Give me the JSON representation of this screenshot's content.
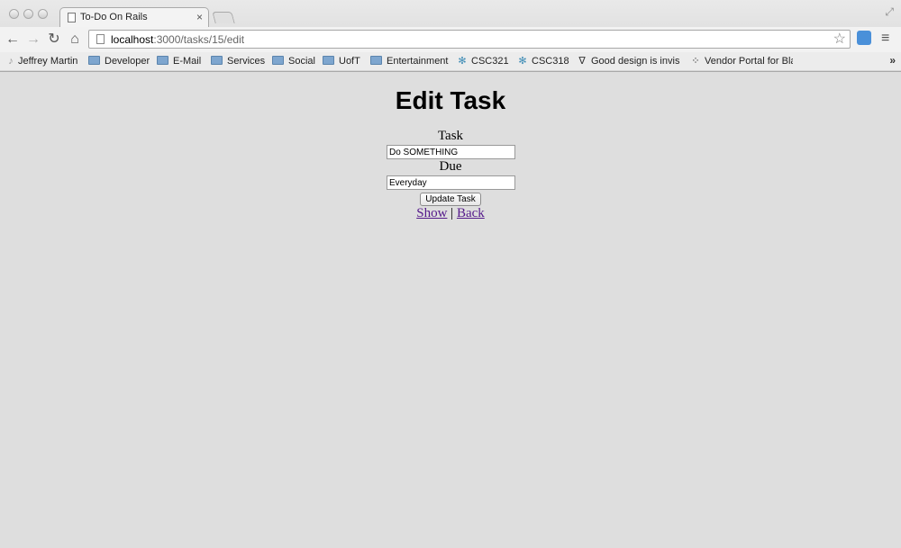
{
  "browser": {
    "tab_title": "To-Do On Rails",
    "tab_close": "×",
    "url_host": "localhost",
    "url_rest": ":3000/tasks/15/edit",
    "bookmarks": [
      {
        "label": "Jeffrey Martin",
        "icon": "person-icon"
      },
      {
        "label": "Developer",
        "icon": "folder-icon"
      },
      {
        "label": "E-Mail",
        "icon": "folder-icon"
      },
      {
        "label": "Services",
        "icon": "folder-icon"
      },
      {
        "label": "Social",
        "icon": "folder-icon"
      },
      {
        "label": "UofT",
        "icon": "folder-icon"
      },
      {
        "label": "Entertainment",
        "icon": "folder-icon"
      },
      {
        "label": "CSC321",
        "icon": "snowflake-icon"
      },
      {
        "label": "CSC318",
        "icon": "snowflake-icon"
      },
      {
        "label": "Good design is invis",
        "icon": "v-logo-icon"
      },
      {
        "label": "Vendor Portal for Bla",
        "icon": "blackberry-icon"
      }
    ],
    "bookmarks_more": "»"
  },
  "page": {
    "heading": "Edit Task",
    "task_label": "Task",
    "task_value": "Do SOMETHING",
    "due_label": "Due",
    "due_value": "Everyday",
    "submit_label": "Update Task",
    "show_link": "Show",
    "separator": "|",
    "back_link": "Back"
  }
}
